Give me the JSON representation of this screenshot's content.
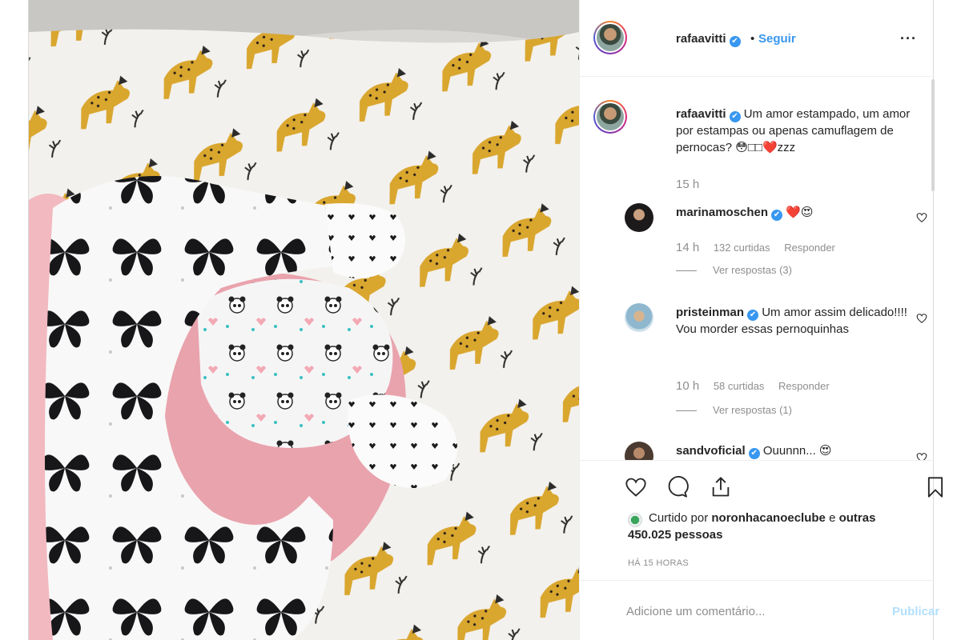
{
  "post": {
    "author": {
      "username": "rafaavitti",
      "verified_mark": "✔",
      "separator": "•",
      "follow_label": "Seguir"
    },
    "more_icon": "more-options-icon",
    "caption": {
      "username": "rafaavitti",
      "text": "Um amor estampado, um amor por estampas ou apenas camuflagem de pernocas? 😳□□❤️zzz",
      "time": "15 h"
    },
    "comments": [
      {
        "username": "marinamoschen",
        "text": "❤️😍",
        "time": "14 h",
        "likes": "132 curtidas",
        "reply_label": "Responder",
        "view_replies": "Ver respostas (3)"
      },
      {
        "username": "pristeinman",
        "text": "Um amor assim delicado!!!! Vou morder essas pernoquinhas",
        "time": "10 h",
        "likes": "58 curtidas",
        "reply_label": "Responder",
        "view_replies": "Ver respostas (1)"
      },
      {
        "username": "sandvoficial",
        "text": "Ouunnn... 😍"
      }
    ],
    "liked_by": {
      "prefix": "Curtido por",
      "user": "noronhacanoeclube",
      "suffix": "e",
      "others": "outras 450.025 pessoas"
    },
    "time_ago": "HÁ 15 HORAS",
    "add_comment": {
      "placeholder": "Adicione um comentário...",
      "publish_label": "Publicar"
    }
  },
  "colors": {
    "accent": "#3897f0",
    "text": "#262626",
    "muted": "#8e8e8e",
    "publish_disabled": "#b2dffc",
    "heart": "#e0245e"
  }
}
